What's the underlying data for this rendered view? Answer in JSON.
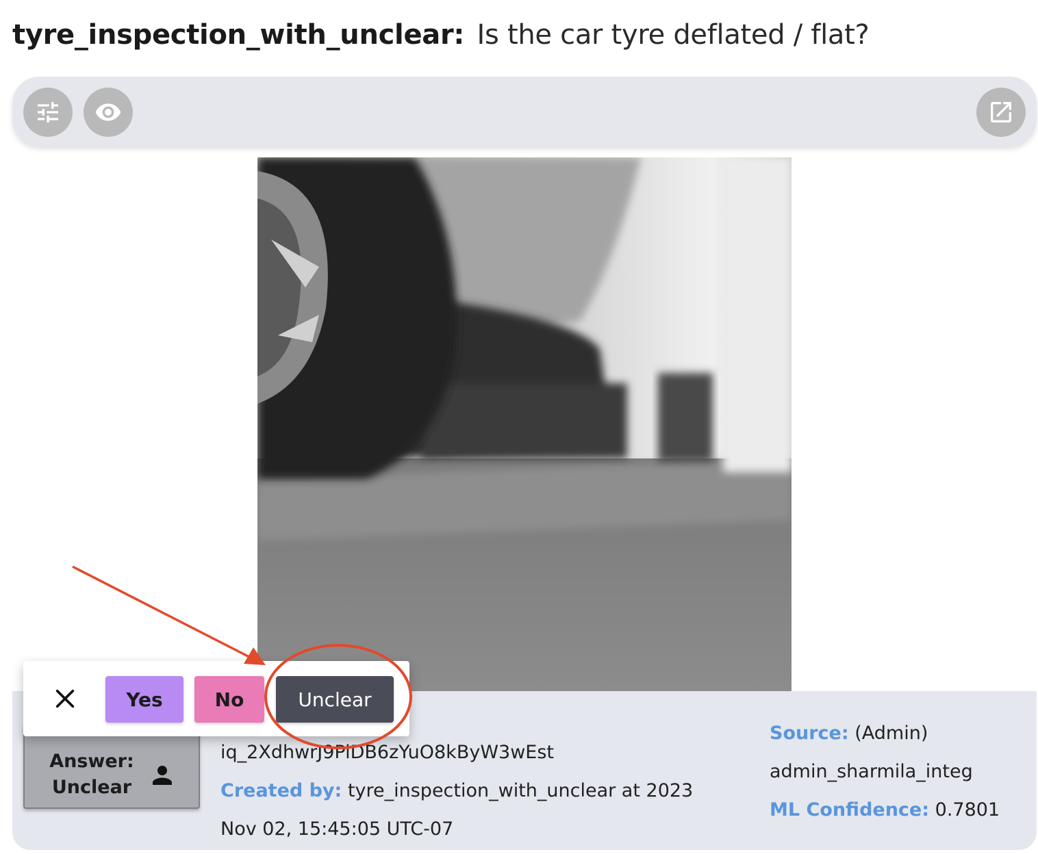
{
  "header": {
    "detector_name": "tyre_inspection_with_unclear:",
    "question": "Is the car tyre deflated / flat?"
  },
  "toolbar": {
    "icons": [
      "tune-icon",
      "eye-icon",
      "open-in-new-icon"
    ]
  },
  "image": {
    "description_icon": "image-preview"
  },
  "answer": {
    "line1": "Answer:",
    "line2": "Unclear",
    "icon": "person-icon"
  },
  "query": {
    "id": "iq_2XdhwrJ9PiDB6zYuO8kByW3wEst",
    "created_by_label": "Created by:",
    "created_by_value": "tyre_inspection_with_unclear at 2023",
    "created_at_cont": "Nov 02, 15:45:05 UTC-07"
  },
  "source": {
    "label": "Source:",
    "value_line1": "(Admin)",
    "value_line2": "admin_sharmila_integ",
    "confidence_label": "ML Confidence:",
    "confidence_value": "0.7801"
  },
  "popup": {
    "close_icon": "close-icon",
    "yes_label": "Yes",
    "no_label": "No",
    "unclear_label": "Unclear",
    "colors": {
      "yes": "#b78bf3",
      "no": "#e97bb7",
      "unclear": "#4a4d57"
    }
  },
  "annotation": {
    "color": "#e24a2c",
    "arrow_icon": "arrow-annotation",
    "circle_icon": "circle-highlight"
  }
}
